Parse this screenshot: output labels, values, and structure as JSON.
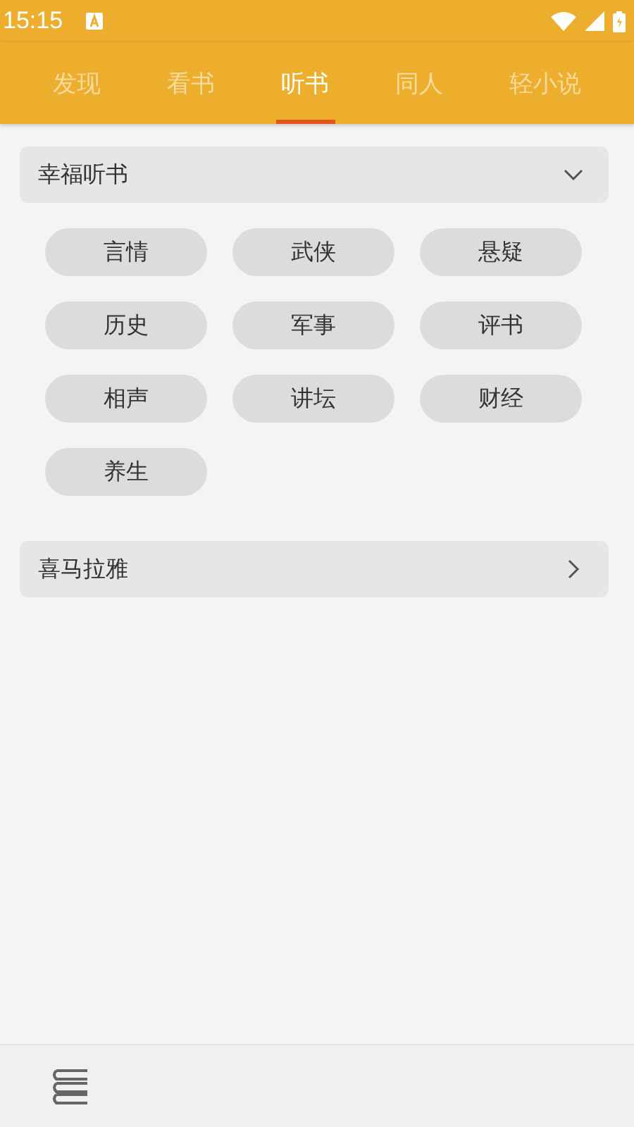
{
  "status_bar": {
    "time": "15:15"
  },
  "tabs": [
    {
      "label": "发现",
      "selected": false
    },
    {
      "label": "看书",
      "selected": false
    },
    {
      "label": "听书",
      "selected": true
    },
    {
      "label": "同人",
      "selected": false
    },
    {
      "label": "轻小说",
      "selected": false
    }
  ],
  "sections": [
    {
      "title": "幸福听书",
      "expanded": true,
      "tags": [
        "言情",
        "武侠",
        "悬疑",
        "历史",
        "军事",
        "评书",
        "相声",
        "讲坛",
        "财经",
        "养生"
      ]
    },
    {
      "title": "喜马拉雅",
      "expanded": false
    }
  ]
}
